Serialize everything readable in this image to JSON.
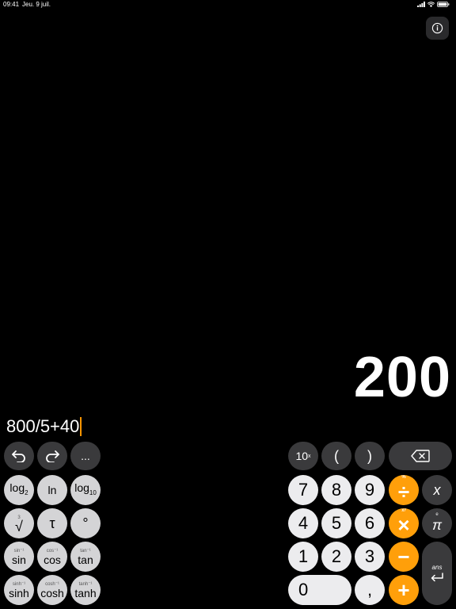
{
  "status": {
    "time": "09:41",
    "date": "Jeu. 9 juil."
  },
  "display": {
    "result": "200",
    "expression": "800/5+40"
  },
  "toolbar": {
    "more": "..."
  },
  "sci": {
    "log2": "log",
    "log2_sub": "2",
    "ln": "ln",
    "log10": "log",
    "log10_sub": "10",
    "sqrt": "√",
    "sqrt_sup": "3",
    "tau": "τ",
    "deg": "°",
    "sin": "sin",
    "sin_sup": "sin⁻¹",
    "cos": "cos",
    "cos_sup": "cos⁻¹",
    "tan": "tan",
    "tan_sup": "tan⁻¹",
    "sinh": "sinh",
    "sinh_sup": "sinh⁻¹",
    "cosh": "cosh",
    "cosh_sup": "cosh⁻¹",
    "tanh": "tanh",
    "tanh_sup": "tanh⁻¹"
  },
  "pad": {
    "pow10": "10",
    "pow10_sup": "x",
    "lparen": "(",
    "rparen": ")",
    "n7": "7",
    "n8": "8",
    "n9": "9",
    "n4": "4",
    "n5": "5",
    "n6": "6",
    "n1": "1",
    "n2": "2",
    "n3": "3",
    "n0": "0",
    "comma": ",",
    "divide": "÷",
    "divide_sup": "%",
    "multiply": "×",
    "multiply_sup": "xʸ",
    "minus": "−",
    "plus": "+",
    "x": "x",
    "pi": "π",
    "pi_sup": "e",
    "ans": "ans"
  },
  "colors": {
    "orange": "#ff9f0a",
    "caret": "#ff9500"
  }
}
